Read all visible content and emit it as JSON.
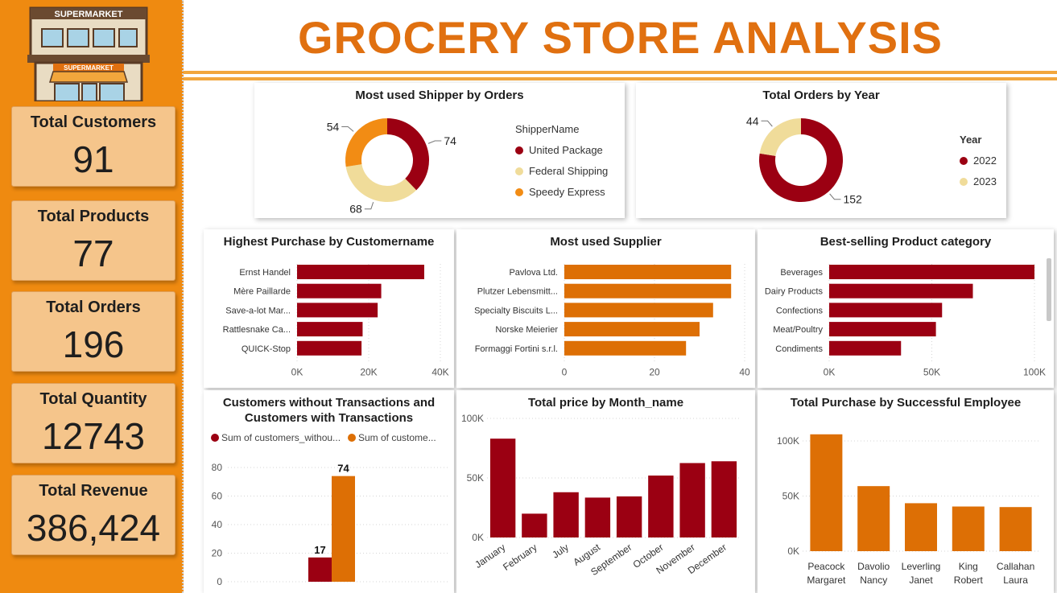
{
  "title": "GROCERY STORE ANALYSIS",
  "logo_text": "SUPERMARKET",
  "colors": {
    "sidebar": "#ef8a10",
    "kpi_bg": "#f5c58b",
    "title": "#e07010",
    "dark_red": "#9b0012",
    "orange": "#dd6f05",
    "beige": "#f0dc9a",
    "light_orange": "#f28c14"
  },
  "kpis": [
    {
      "label": "Total Customers",
      "value": "91"
    },
    {
      "label": "Total Products",
      "value": "77"
    },
    {
      "label": "Total Orders",
      "value": "196"
    },
    {
      "label": "Total Quantity",
      "value": "12743"
    },
    {
      "label": "Total Revenue",
      "value": "386,424"
    }
  ],
  "chart_data": [
    {
      "id": "shipper",
      "type": "pie",
      "title": "Most used Shipper by Orders",
      "legend_title": "ShipperName",
      "legend_position": "right",
      "labels": [
        "United Package",
        "Federal Shipping",
        "Speedy Express"
      ],
      "values": [
        74,
        68,
        54
      ],
      "colors": [
        "#9b0012",
        "#f0dc9a",
        "#f28c14"
      ]
    },
    {
      "id": "orders_year",
      "type": "pie",
      "title": "Total Orders by Year",
      "legend_title": "Year",
      "legend_position": "right",
      "labels": [
        "2022",
        "2023"
      ],
      "values": [
        152,
        44
      ],
      "colors": [
        "#9b0012",
        "#f0dc9a"
      ]
    },
    {
      "id": "customers",
      "type": "bar",
      "orientation": "horizontal",
      "title": "Highest Purchase by Customername",
      "categories": [
        "Ernst Handel",
        "Mère Paillarde",
        "Save-a-lot Mar...",
        "Rattlesnake Ca...",
        "QUICK-Stop"
      ],
      "values": [
        35500,
        23500,
        22500,
        18300,
        18000
      ],
      "xlim": [
        0,
        40000
      ],
      "ticks": [
        "0K",
        "20K",
        "40K"
      ],
      "tick_values": [
        0,
        20000,
        40000
      ],
      "color": "#9b0012"
    },
    {
      "id": "supplier",
      "type": "bar",
      "orientation": "horizontal",
      "title": "Most used Supplier",
      "categories": [
        "Pavlova Ltd.",
        "Plutzer Lebensmitt...",
        "Specialty Biscuits L...",
        "Norske Meierier",
        "Formaggi Fortini s.r.l."
      ],
      "values": [
        37,
        37,
        33,
        30,
        27
      ],
      "xlim": [
        0,
        40
      ],
      "ticks": [
        "0",
        "20",
        "40"
      ],
      "tick_values": [
        0,
        20,
        40
      ],
      "color": "#dd6f05"
    },
    {
      "id": "category",
      "type": "bar",
      "orientation": "horizontal",
      "title": "Best-selling Product category",
      "categories": [
        "Beverages",
        "Dairy Products",
        "Confections",
        "Meat/Poultry",
        "Condiments"
      ],
      "values": [
        100000,
        70000,
        55000,
        52000,
        35000
      ],
      "xlim": [
        0,
        100000
      ],
      "ticks": [
        "0K",
        "50K",
        "100K"
      ],
      "tick_values": [
        0,
        50000,
        100000
      ],
      "color": "#9b0012"
    },
    {
      "id": "transactions",
      "type": "bar",
      "title": "Customers without Transactions and Customers with Transactions",
      "series": [
        {
          "name": "Sum of customers_withou...",
          "values": [
            17
          ],
          "color": "#9b0012"
        },
        {
          "name": "Sum of custome...",
          "values": [
            74
          ],
          "color": "#dd6f05"
        }
      ],
      "data_labels": [
        "17",
        "74"
      ],
      "ylim": [
        0,
        80
      ],
      "ticks": [
        "0",
        "20",
        "40",
        "60",
        "80"
      ],
      "tick_values": [
        0,
        20,
        40,
        60,
        80
      ],
      "legend_position": "top-left"
    },
    {
      "id": "month",
      "type": "bar",
      "title": "Total price by Month_name",
      "categories": [
        "January",
        "February",
        "July",
        "August",
        "September",
        "October",
        "November",
        "December"
      ],
      "values": [
        83000,
        20000,
        38000,
        33500,
        34500,
        52000,
        62500,
        64000
      ],
      "ylim": [
        0,
        100000
      ],
      "ticks": [
        "0K",
        "50K",
        "100K"
      ],
      "tick_values": [
        0,
        50000,
        100000
      ],
      "color": "#9b0012"
    },
    {
      "id": "employee",
      "type": "bar",
      "title": "Total Purchase by Successful Employee",
      "categories": [
        [
          "Peacock",
          "Margaret"
        ],
        [
          "Davolio",
          "Nancy"
        ],
        [
          "Leverling",
          "Janet"
        ],
        [
          "King",
          "Robert"
        ],
        [
          "Callahan",
          "Laura"
        ]
      ],
      "values": [
        106000,
        59000,
        43500,
        40500,
        40000
      ],
      "ylim": [
        0,
        100000
      ],
      "ticks": [
        "0K",
        "50K",
        "100K"
      ],
      "tick_values": [
        0,
        50000,
        100000
      ],
      "color": "#dd6f05"
    }
  ]
}
